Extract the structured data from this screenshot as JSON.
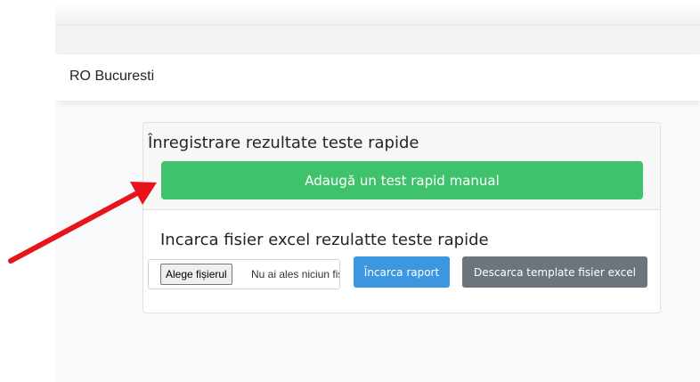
{
  "navbar": {
    "brand": "RO Bucuresti"
  },
  "card": {
    "title": "Înregistrare rezultate teste rapide",
    "add_button": "Adaugă un test rapid manual",
    "upload_title": "Incarca fisier excel rezulatte teste rapide",
    "file_input": {
      "button_label": "Alege fișierul",
      "status": "Nu ai ales niciun fișier"
    },
    "upload_button": "Încarca raport",
    "template_button": "Descarca template fisier excel"
  },
  "colors": {
    "add_button": "#3ec36c",
    "upload_button": "#3d97e0",
    "template_button": "#6c757d",
    "arrow": "#e8141b"
  },
  "icons": {
    "annotation": "red-arrow"
  }
}
